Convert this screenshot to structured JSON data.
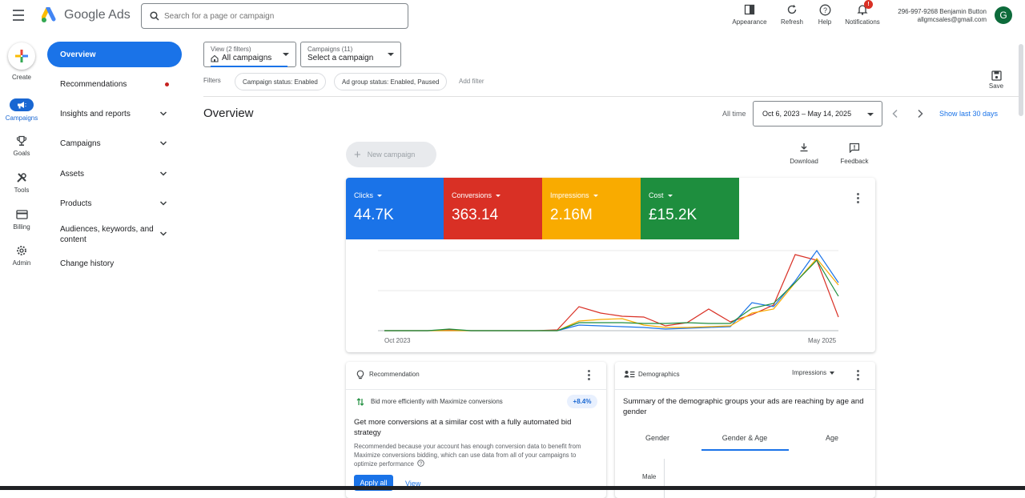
{
  "header": {
    "app_name": "Google Ads",
    "search_placeholder": "Search for a page or campaign",
    "actions": [
      {
        "label": "Appearance",
        "icon": "appearance-icon"
      },
      {
        "label": "Refresh",
        "icon": "refresh-icon"
      },
      {
        "label": "Help",
        "icon": "help-icon"
      },
      {
        "label": "Notifications",
        "icon": "bell-icon",
        "badge": "!"
      }
    ],
    "account_line1": "296-997-9268 Benjamin Button",
    "account_line2": "allgmcsales@gmail.com",
    "avatar_letter": "G"
  },
  "rail": {
    "create": "Create",
    "items": [
      {
        "label": "Campaigns",
        "icon": "megaphone-icon",
        "active": true
      },
      {
        "label": "Goals",
        "icon": "trophy-icon"
      },
      {
        "label": "Tools",
        "icon": "tools-icon"
      },
      {
        "label": "Billing",
        "icon": "credit-card-icon"
      },
      {
        "label": "Admin",
        "icon": "gear-icon"
      }
    ]
  },
  "nav": {
    "overview": "Overview",
    "recommendations": "Recommendations",
    "insights": "Insights and reports",
    "campaigns": "Campaigns",
    "assets": "Assets",
    "products": "Products",
    "audiences_line1": "Audiences, keywords, and",
    "audiences_line2": "content",
    "change_history": "Change history"
  },
  "view_selector": {
    "small": "View (2 filters)",
    "value": "All campaigns"
  },
  "campaign_selector": {
    "small": "Campaigns (11)",
    "value": "Select a campaign"
  },
  "filters": {
    "label": "Filters",
    "chips": [
      "Campaign status: Enabled",
      "Ad group status: Enabled, Paused"
    ],
    "add": "Add filter"
  },
  "save_label": "Save",
  "page_title": "Overview",
  "date": {
    "all_time": "All time",
    "range": "Oct 6, 2023 – May 14, 2025",
    "show_last": "Show last 30 days"
  },
  "new_campaign": "New campaign",
  "download": "Download",
  "feedback": "Feedback",
  "metrics": [
    {
      "label": "Clicks",
      "value": "44.7K",
      "color": "#1a73e8"
    },
    {
      "label": "Conversions",
      "value": "363.14",
      "color": "#d93025"
    },
    {
      "label": "Impressions",
      "value": "2.16M",
      "color": "#f9ab00"
    },
    {
      "label": "Cost",
      "value": "£15.2K",
      "color": "#1e8e3e"
    }
  ],
  "chart_data": {
    "type": "line",
    "x_start_label": "Oct 2023",
    "x_end_label": "May 2025",
    "grid": true,
    "note": "relative trend, no y-axis values shown",
    "series": [
      {
        "color": "#d93025",
        "values": [
          0,
          0,
          0,
          0.01,
          0,
          0,
          0,
          0,
          0.01,
          0.3,
          0.22,
          0.18,
          0.17,
          0.06,
          0.1,
          0.27,
          0.11,
          0.2,
          0.32,
          0.95,
          0.88,
          0.17
        ]
      },
      {
        "color": "#1a73e8",
        "values": [
          0,
          0,
          0,
          0,
          0,
          0,
          0,
          0,
          0,
          0.07,
          0.06,
          0.05,
          0.04,
          0.02,
          0.03,
          0.04,
          0.05,
          0.35,
          0.3,
          0.62,
          1.0,
          0.6
        ]
      },
      {
        "color": "#f9ab00",
        "values": [
          0,
          0,
          0,
          0,
          0,
          0,
          0,
          0,
          0,
          0.12,
          0.14,
          0.15,
          0.07,
          0.04,
          0.04,
          0.05,
          0.06,
          0.22,
          0.27,
          0.6,
          0.9,
          0.57
        ]
      },
      {
        "color": "#1e8e3e",
        "values": [
          0,
          0,
          0,
          0.02,
          0,
          0,
          0,
          0,
          0,
          0.1,
          0.1,
          0.1,
          0.09,
          0.09,
          0.1,
          0.09,
          0.09,
          0.28,
          0.34,
          0.6,
          0.88,
          0.43
        ]
      }
    ]
  },
  "recommendation": {
    "title": "Recommendation",
    "item": "Bid more efficiently with Maximize conversions",
    "delta": "+8.4%",
    "headline": "Get more conversions at a similar cost with a fully automated bid strategy",
    "body": "Recommended because your account has enough conversion data to benefit from Maximize conversions bidding, which can use data from all of your campaigns to optimize performance",
    "apply": "Apply all",
    "view": "View"
  },
  "demographics": {
    "title": "Demographics",
    "metric": "Impressions",
    "summary": "Summary of the demographic groups your ads are reaching by age and gender",
    "tabs": [
      "Gender",
      "Gender & Age",
      "Age"
    ],
    "row_label": "Male"
  }
}
